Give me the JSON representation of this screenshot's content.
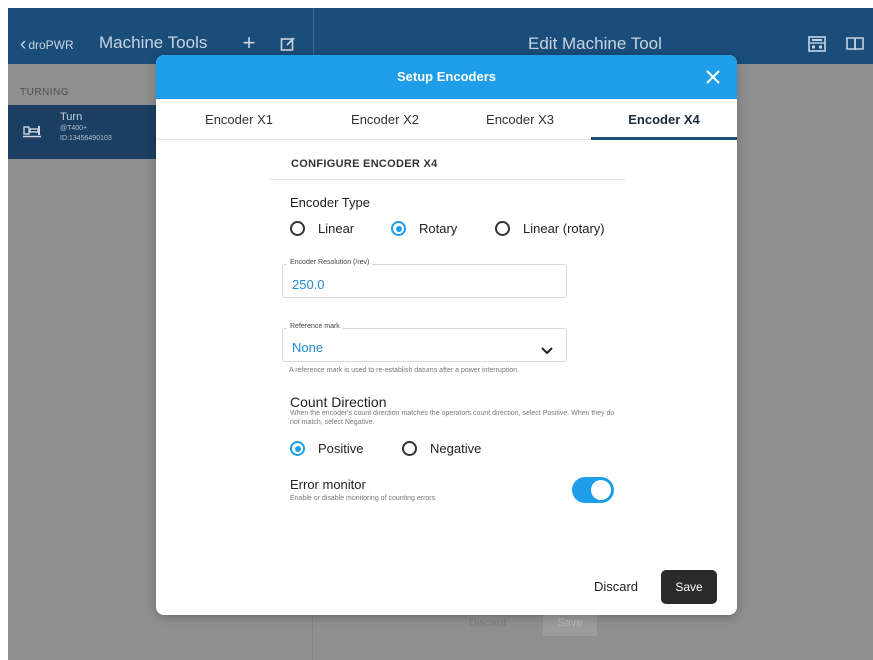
{
  "topbar": {
    "back_label": "droPWR",
    "title": "Machine Tools",
    "detail_title": "Edit Machine Tool",
    "icons": {
      "back": "chevron-left-icon",
      "add": "plus-icon",
      "edit": "edit-icon",
      "calculator": "calculator-icon",
      "book": "book-icon"
    }
  },
  "sidebar": {
    "section_label": "TURNING",
    "machine": {
      "name": "Turn",
      "model": "@T400+",
      "id": "ID:13456490103",
      "icon": "lathe-icon"
    }
  },
  "background_footer": {
    "discard_label": "Discard",
    "save_label": "Save"
  },
  "modal": {
    "title": "Setup Encoders",
    "tabs": [
      {
        "label": "Encoder X1",
        "active": false
      },
      {
        "label": "Encoder X2",
        "active": false
      },
      {
        "label": "Encoder X3",
        "active": false
      },
      {
        "label": "Encoder X4",
        "active": true
      }
    ],
    "section_header": "CONFIGURE ENCODER X4",
    "encoder_type": {
      "label": "Encoder Type",
      "options": [
        {
          "label": "Linear",
          "selected": false
        },
        {
          "label": "Rotary",
          "selected": true
        },
        {
          "label": "Linear (rotary)",
          "selected": false
        }
      ]
    },
    "resolution": {
      "label": "Encoder Resolution (/rev)",
      "value": "250.0"
    },
    "reference_mark": {
      "label": "Reference mark",
      "value": "None",
      "helper": "A reference mark is used to re-establish datums after a power interruption."
    },
    "count_direction": {
      "label": "Count Direction",
      "helper": "When the encoder's count direction matches the operators count direction, select Positive. When they do not match, select Negative.",
      "options": [
        {
          "label": "Positive",
          "selected": true
        },
        {
          "label": "Negative",
          "selected": false
        }
      ]
    },
    "error_monitor": {
      "label": "Error monitor",
      "helper": "Enable or disable monitoring of counting errors",
      "enabled": true
    },
    "discard_label": "Discard",
    "save_label": "Save"
  },
  "colors": {
    "topbar": "#1a4d7a",
    "modal_header": "#1e9ee8",
    "accent": "#1e9ee8",
    "save_button": "#2a2a2a",
    "overlay": "#8f8f8f"
  }
}
